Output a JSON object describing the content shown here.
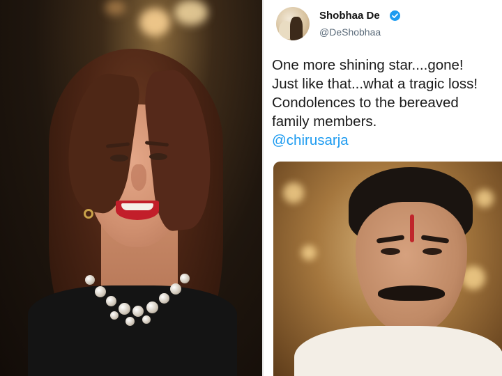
{
  "tweet": {
    "author_name": "Shobhaa De",
    "handle": "@DeShobhaa",
    "verified": true,
    "lines": [
      "One more shining star....gone!",
      "Just like that...what a tragic loss!",
      "Condolences to the bereaved",
      "family members."
    ],
    "mention": "@chirusarja"
  },
  "colors": {
    "link": "#1d9bf0",
    "verified_badge": "#1d9bf0",
    "handle_text": "#5b6b7a"
  },
  "icons": {
    "verified": "verified-badge-icon"
  }
}
